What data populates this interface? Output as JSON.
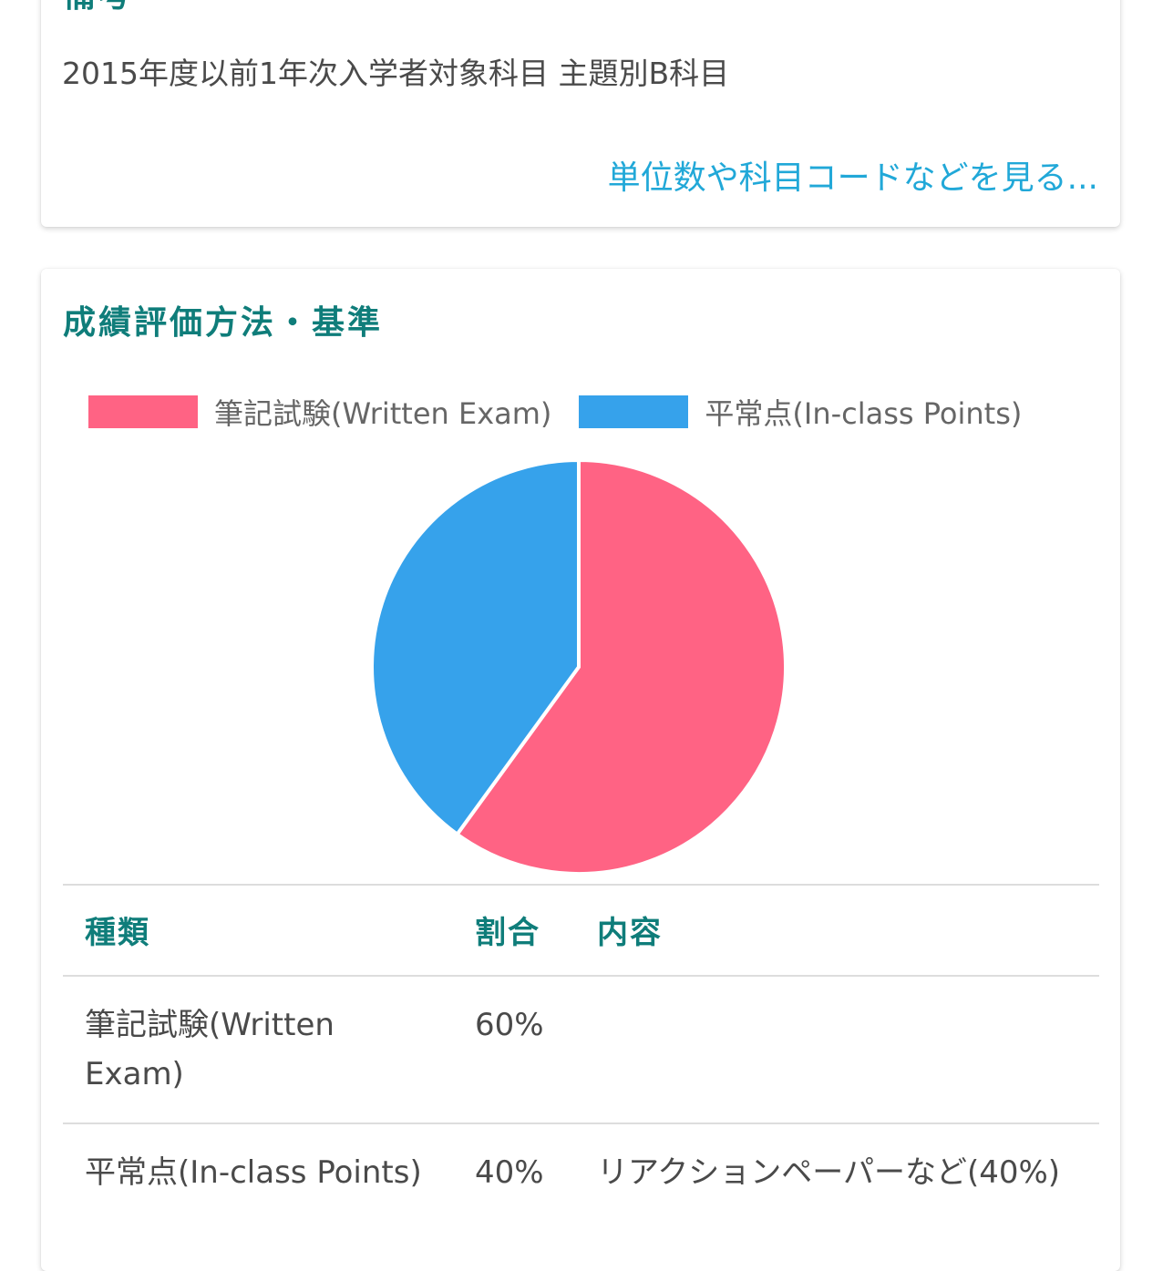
{
  "notes_card": {
    "title": "備考",
    "text": "2015年度以前1年次入学者対象科目 主題別B科目",
    "more_link": "単位数や科目コードなどを見る..."
  },
  "evaluation_card": {
    "title": "成績評価方法・基準",
    "legend": [
      {
        "label": "筆記試験(Written Exam)",
        "color": "#ff6384"
      },
      {
        "label": "平常点(In-class Points)",
        "color": "#36a2eb"
      }
    ],
    "table": {
      "headers": {
        "type": "種類",
        "ratio": "割合",
        "content": "内容"
      },
      "rows": [
        {
          "type": "筆記試験(Written Exam)",
          "ratio": "60%",
          "content": ""
        },
        {
          "type": "平常点(In-class Points)",
          "ratio": "40%",
          "content": "リアクションペーパーなど(40%)"
        }
      ]
    }
  },
  "chart_data": {
    "type": "pie",
    "categories": [
      "筆記試験(Written Exam)",
      "平常点(In-class Points)"
    ],
    "values": [
      60,
      40
    ],
    "colors": [
      "#ff6384",
      "#36a2eb"
    ],
    "legend_position": "top"
  }
}
